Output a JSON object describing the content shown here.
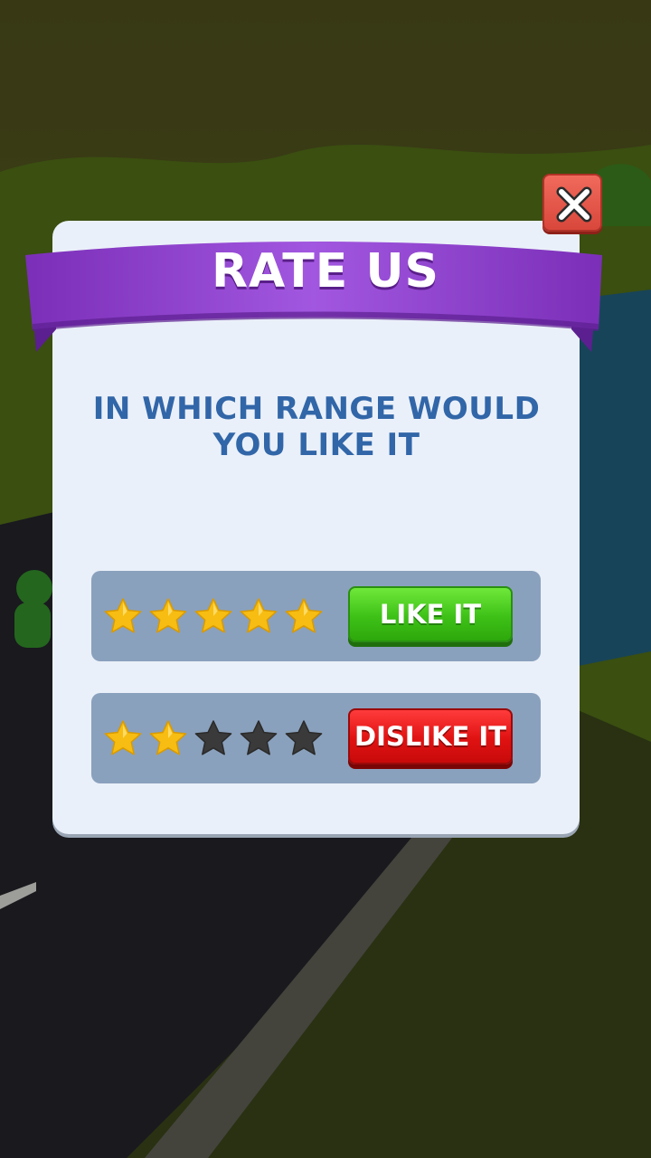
{
  "popup": {
    "title": "RATE US",
    "question": "IN WHICH RANGE WOULD YOU LIKE IT"
  },
  "options": [
    {
      "stars_filled": 5,
      "stars_total": 5,
      "label": "LIKE IT"
    },
    {
      "stars_filled": 2,
      "stars_total": 5,
      "label": "DISLIKE IT"
    }
  ],
  "icons": {
    "close": "close-icon",
    "star": "star-icon"
  },
  "colors": {
    "ribbon": "#8e3fd0",
    "question_text": "#3166a8",
    "star_filled": "#f7bd12",
    "star_empty": "#3a3a3a",
    "like_button": "#3ec117",
    "dislike_button": "#e01212",
    "close_button": "#e3564a"
  }
}
